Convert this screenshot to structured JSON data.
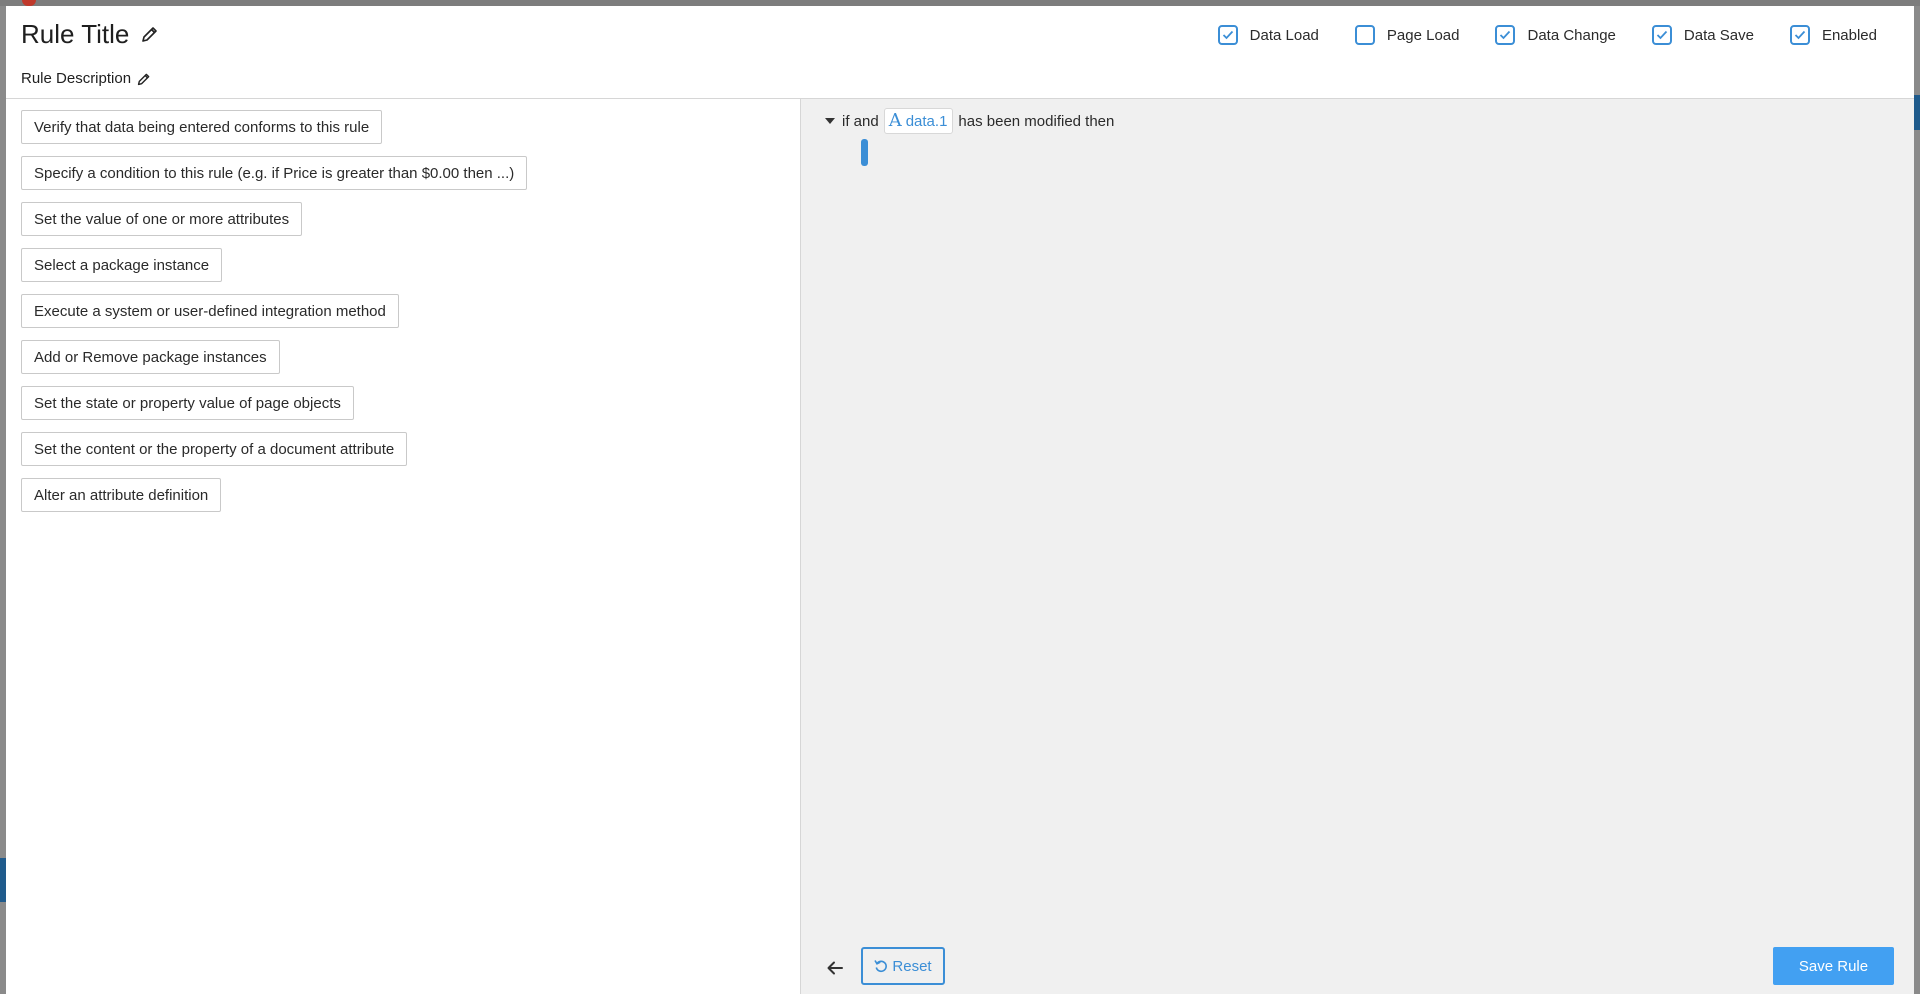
{
  "header": {
    "title": "Rule Title",
    "description": "Rule Description",
    "checkboxes": [
      {
        "label": "Data Load",
        "checked": true
      },
      {
        "label": "Page Load",
        "checked": false
      },
      {
        "label": "Data Change",
        "checked": true
      },
      {
        "label": "Data Save",
        "checked": true
      },
      {
        "label": "Enabled",
        "checked": true
      }
    ]
  },
  "options": [
    "Verify that data being entered conforms to this rule",
    "Specify a condition to this rule (e.g. if Price is greater than $0.00 then ...)",
    "Set the value of one or more attributes",
    "Select a package instance",
    "Execute a system or user-defined integration method",
    "Add or Remove package instances",
    "Set the state or property value of page objects",
    "Set the content or the property of a document attribute",
    "Alter an attribute definition"
  ],
  "rule": {
    "prefix": "if and",
    "attribute_icon": "A",
    "attribute": "data.1",
    "suffix": "has been modified then"
  },
  "footer": {
    "reset_label": "Reset",
    "save_label": "Save Rule"
  },
  "colors": {
    "accent": "#3b8ed6",
    "save_button": "#42a0f2",
    "editor_bg": "#f0f0f0"
  },
  "icons": {
    "title_edit": "pencil-icon",
    "description_edit": "pencil-icon",
    "checkbox_checked": "checkmark-icon",
    "collapse": "caret-down-icon",
    "attribute_type": "text-attribute-icon",
    "back": "arrow-left-icon",
    "reset": "undo-icon"
  }
}
